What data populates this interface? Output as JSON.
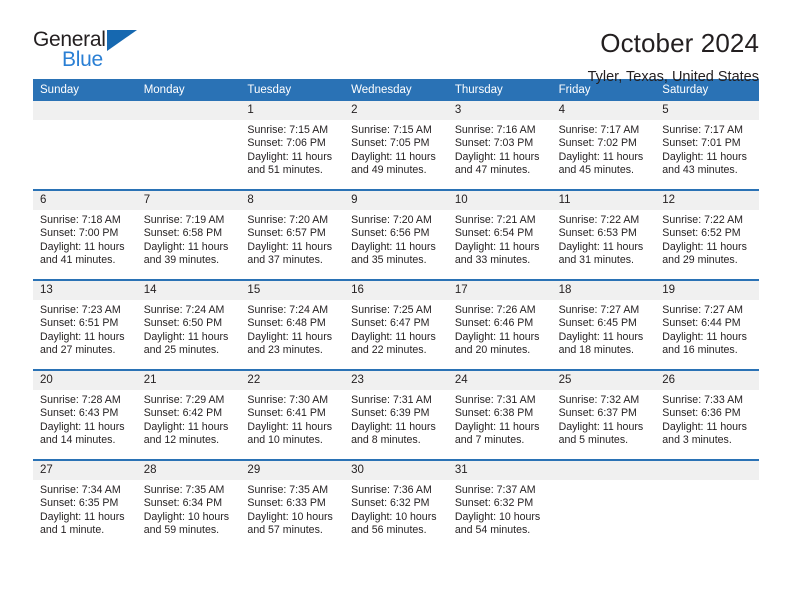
{
  "brand": {
    "name_part1": "General",
    "name_part2": "Blue",
    "accent_color": "#2a7fd4",
    "triangle_color": "#1668b0"
  },
  "header": {
    "title": "October 2024",
    "subtitle": "Tyler, Texas, United States"
  },
  "theme": {
    "header_blue": "#2a72b5",
    "day_band_gray": "#f0f0f0",
    "text_color": "#231f20"
  },
  "weekdays": [
    "Sunday",
    "Monday",
    "Tuesday",
    "Wednesday",
    "Thursday",
    "Friday",
    "Saturday"
  ],
  "weeks": [
    [
      {
        "day": "",
        "empty": true
      },
      {
        "day": "",
        "empty": true
      },
      {
        "day": "1",
        "sunrise": "Sunrise: 7:15 AM",
        "sunset": "Sunset: 7:06 PM",
        "daylight": "Daylight: 11 hours and 51 minutes."
      },
      {
        "day": "2",
        "sunrise": "Sunrise: 7:15 AM",
        "sunset": "Sunset: 7:05 PM",
        "daylight": "Daylight: 11 hours and 49 minutes."
      },
      {
        "day": "3",
        "sunrise": "Sunrise: 7:16 AM",
        "sunset": "Sunset: 7:03 PM",
        "daylight": "Daylight: 11 hours and 47 minutes."
      },
      {
        "day": "4",
        "sunrise": "Sunrise: 7:17 AM",
        "sunset": "Sunset: 7:02 PM",
        "daylight": "Daylight: 11 hours and 45 minutes."
      },
      {
        "day": "5",
        "sunrise": "Sunrise: 7:17 AM",
        "sunset": "Sunset: 7:01 PM",
        "daylight": "Daylight: 11 hours and 43 minutes."
      }
    ],
    [
      {
        "day": "6",
        "sunrise": "Sunrise: 7:18 AM",
        "sunset": "Sunset: 7:00 PM",
        "daylight": "Daylight: 11 hours and 41 minutes."
      },
      {
        "day": "7",
        "sunrise": "Sunrise: 7:19 AM",
        "sunset": "Sunset: 6:58 PM",
        "daylight": "Daylight: 11 hours and 39 minutes."
      },
      {
        "day": "8",
        "sunrise": "Sunrise: 7:20 AM",
        "sunset": "Sunset: 6:57 PM",
        "daylight": "Daylight: 11 hours and 37 minutes."
      },
      {
        "day": "9",
        "sunrise": "Sunrise: 7:20 AM",
        "sunset": "Sunset: 6:56 PM",
        "daylight": "Daylight: 11 hours and 35 minutes."
      },
      {
        "day": "10",
        "sunrise": "Sunrise: 7:21 AM",
        "sunset": "Sunset: 6:54 PM",
        "daylight": "Daylight: 11 hours and 33 minutes."
      },
      {
        "day": "11",
        "sunrise": "Sunrise: 7:22 AM",
        "sunset": "Sunset: 6:53 PM",
        "daylight": "Daylight: 11 hours and 31 minutes."
      },
      {
        "day": "12",
        "sunrise": "Sunrise: 7:22 AM",
        "sunset": "Sunset: 6:52 PM",
        "daylight": "Daylight: 11 hours and 29 minutes."
      }
    ],
    [
      {
        "day": "13",
        "sunrise": "Sunrise: 7:23 AM",
        "sunset": "Sunset: 6:51 PM",
        "daylight": "Daylight: 11 hours and 27 minutes."
      },
      {
        "day": "14",
        "sunrise": "Sunrise: 7:24 AM",
        "sunset": "Sunset: 6:50 PM",
        "daylight": "Daylight: 11 hours and 25 minutes."
      },
      {
        "day": "15",
        "sunrise": "Sunrise: 7:24 AM",
        "sunset": "Sunset: 6:48 PM",
        "daylight": "Daylight: 11 hours and 23 minutes."
      },
      {
        "day": "16",
        "sunrise": "Sunrise: 7:25 AM",
        "sunset": "Sunset: 6:47 PM",
        "daylight": "Daylight: 11 hours and 22 minutes."
      },
      {
        "day": "17",
        "sunrise": "Sunrise: 7:26 AM",
        "sunset": "Sunset: 6:46 PM",
        "daylight": "Daylight: 11 hours and 20 minutes."
      },
      {
        "day": "18",
        "sunrise": "Sunrise: 7:27 AM",
        "sunset": "Sunset: 6:45 PM",
        "daylight": "Daylight: 11 hours and 18 minutes."
      },
      {
        "day": "19",
        "sunrise": "Sunrise: 7:27 AM",
        "sunset": "Sunset: 6:44 PM",
        "daylight": "Daylight: 11 hours and 16 minutes."
      }
    ],
    [
      {
        "day": "20",
        "sunrise": "Sunrise: 7:28 AM",
        "sunset": "Sunset: 6:43 PM",
        "daylight": "Daylight: 11 hours and 14 minutes."
      },
      {
        "day": "21",
        "sunrise": "Sunrise: 7:29 AM",
        "sunset": "Sunset: 6:42 PM",
        "daylight": "Daylight: 11 hours and 12 minutes."
      },
      {
        "day": "22",
        "sunrise": "Sunrise: 7:30 AM",
        "sunset": "Sunset: 6:41 PM",
        "daylight": "Daylight: 11 hours and 10 minutes."
      },
      {
        "day": "23",
        "sunrise": "Sunrise: 7:31 AM",
        "sunset": "Sunset: 6:39 PM",
        "daylight": "Daylight: 11 hours and 8 minutes."
      },
      {
        "day": "24",
        "sunrise": "Sunrise: 7:31 AM",
        "sunset": "Sunset: 6:38 PM",
        "daylight": "Daylight: 11 hours and 7 minutes."
      },
      {
        "day": "25",
        "sunrise": "Sunrise: 7:32 AM",
        "sunset": "Sunset: 6:37 PM",
        "daylight": "Daylight: 11 hours and 5 minutes."
      },
      {
        "day": "26",
        "sunrise": "Sunrise: 7:33 AM",
        "sunset": "Sunset: 6:36 PM",
        "daylight": "Daylight: 11 hours and 3 minutes."
      }
    ],
    [
      {
        "day": "27",
        "sunrise": "Sunrise: 7:34 AM",
        "sunset": "Sunset: 6:35 PM",
        "daylight": "Daylight: 11 hours and 1 minute."
      },
      {
        "day": "28",
        "sunrise": "Sunrise: 7:35 AM",
        "sunset": "Sunset: 6:34 PM",
        "daylight": "Daylight: 10 hours and 59 minutes."
      },
      {
        "day": "29",
        "sunrise": "Sunrise: 7:35 AM",
        "sunset": "Sunset: 6:33 PM",
        "daylight": "Daylight: 10 hours and 57 minutes."
      },
      {
        "day": "30",
        "sunrise": "Sunrise: 7:36 AM",
        "sunset": "Sunset: 6:32 PM",
        "daylight": "Daylight: 10 hours and 56 minutes."
      },
      {
        "day": "31",
        "sunrise": "Sunrise: 7:37 AM",
        "sunset": "Sunset: 6:32 PM",
        "daylight": "Daylight: 10 hours and 54 minutes."
      },
      {
        "day": "",
        "empty": true
      },
      {
        "day": "",
        "empty": true
      }
    ]
  ]
}
